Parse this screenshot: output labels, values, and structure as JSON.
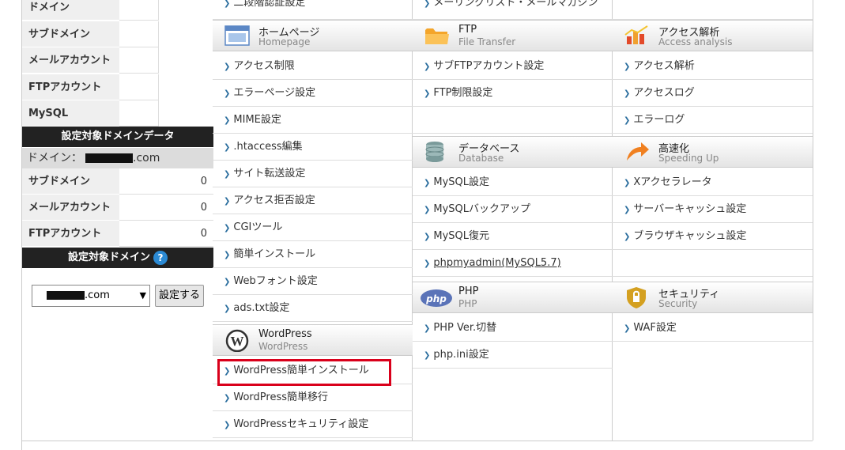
{
  "left": {
    "top_rows": [
      "ドメイン",
      "サブドメイン",
      "メールアカウント",
      "FTPアカウント",
      "MySQL"
    ],
    "domain_data_title": "設定対象ドメインデータ",
    "domain_label": "ドメイン：",
    "domain_suffix": ".com",
    "stats": [
      {
        "label": "サブドメイン",
        "value": "0"
      },
      {
        "label": "メールアカウント",
        "value": "0"
      },
      {
        "label": "FTPアカウント",
        "value": "0"
      }
    ],
    "target_domain_title": "設定対象ドメイン",
    "help_glyph": "?",
    "select_value": ".com",
    "set_button": "設定する"
  },
  "col1": {
    "partial_top": "二段階認証設定",
    "homepage": {
      "jp": "ホームページ",
      "en": "Homepage",
      "items": [
        "アクセス制限",
        "エラーページ設定",
        "MIME設定",
        ".htaccess編集",
        "サイト転送設定",
        "アクセス拒否設定",
        "CGIツール",
        "簡単インストール",
        "Webフォント設定",
        "ads.txt設定"
      ]
    },
    "wordpress": {
      "jp": "WordPress",
      "en": "WordPress",
      "items": [
        "WordPress簡単インストール",
        "WordPress簡単移行",
        "WordPressセキュリティ設定"
      ]
    }
  },
  "col2": {
    "partial_top": "メーリングリスト・メールマガジン",
    "ftp": {
      "jp": "FTP",
      "en": "File Transfer",
      "items": [
        "サブFTPアカウント設定",
        "FTP制限設定"
      ]
    },
    "database": {
      "jp": "データベース",
      "en": "Database",
      "items": [
        "MySQL設定",
        "MySQLバックアップ",
        "MySQL復元",
        "phpmyadmin(MySQL5.7)"
      ]
    },
    "php": {
      "jp": "PHP",
      "en": "PHP",
      "items": [
        "PHP Ver.切替",
        "php.ini設定"
      ]
    }
  },
  "col3": {
    "access": {
      "jp": "アクセス解析",
      "en": "Access analysis",
      "items": [
        "アクセス解析",
        "アクセスログ",
        "エラーログ"
      ]
    },
    "speed": {
      "jp": "高速化",
      "en": "Speeding Up",
      "items": [
        "Xアクセラレータ",
        "サーバーキャッシュ設定",
        "ブラウザキャッシュ設定"
      ]
    },
    "security": {
      "jp": "セキュリティ",
      "en": "Security",
      "items": [
        "WAF設定"
      ]
    }
  },
  "colors": {
    "highlight": "#d9001b",
    "dark_header": "#222222",
    "arrow": "#2b6e9e"
  }
}
